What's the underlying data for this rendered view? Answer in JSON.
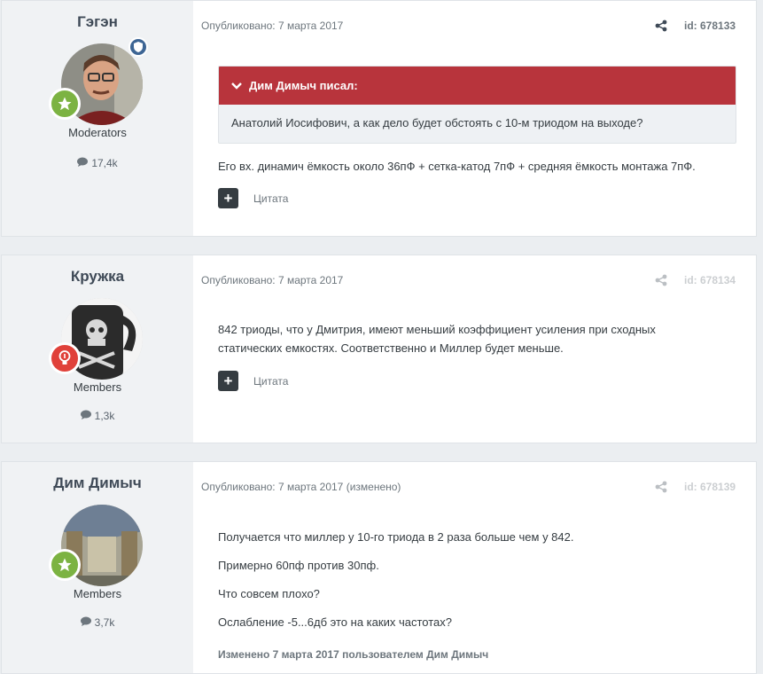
{
  "posts": [
    {
      "author": "Гэгэн",
      "group": "Moderators",
      "post_count": "17,4k",
      "published": "Опубликовано: 7 марта 2017",
      "edited_marker": "",
      "post_id": "id: 678133",
      "quote_author": "Дим Димыч писал:",
      "quote_text": "Анатолий Иосифович, а как дело будет обстоять с 10-м триодом на выходе?",
      "paragraphs": [
        "Его вх. динамич ёмкость около 36пФ + сетка-катод 7пФ + средняя ёмкость монтажа 7пФ."
      ],
      "quote_button": "Цитата"
    },
    {
      "author": "Кружка",
      "group": "Members",
      "post_count": "1,3k",
      "published": "Опубликовано: 7 марта 2017",
      "edited_marker": "",
      "post_id": "id: 678134",
      "paragraphs": [
        "842 триоды, что у Дмитрия, имеют меньший коэффициент усиления при сходных",
        "статических емкостях. Соответственно и Миллер будет меньше."
      ],
      "quote_button": "Цитата"
    },
    {
      "author": "Дим Димыч",
      "group": "Members",
      "post_count": "3,7k",
      "published": "Опубликовано: 7 марта 2017",
      "edited_marker": "(изменено)",
      "post_id": "id: 678139",
      "paragraphs": [
        "Получается что миллер у 10-го триода в 2 раза больше чем у 842.",
        "Примерно 60пф против 30пф.",
        "Что совсем плохо?",
        "Ослабление -5...6дб это на каких частотах?"
      ],
      "edited_note": "Изменено 7 марта 2017 пользователем Дим Димыч"
    }
  ],
  "icons": {
    "share": "share-icon",
    "comment": "comment-icon",
    "rank_star": "star-icon",
    "rank_bulb": "lightbulb-icon",
    "moderator": "shield-icon",
    "quote_toggle": "chevron-down-icon",
    "multiquote": "plus-icon"
  },
  "colors": {
    "quote_header": "#b8343c",
    "rank_green": "#7cb342",
    "rank_red": "#e0413a",
    "moderator_badge": "#3d6594"
  }
}
